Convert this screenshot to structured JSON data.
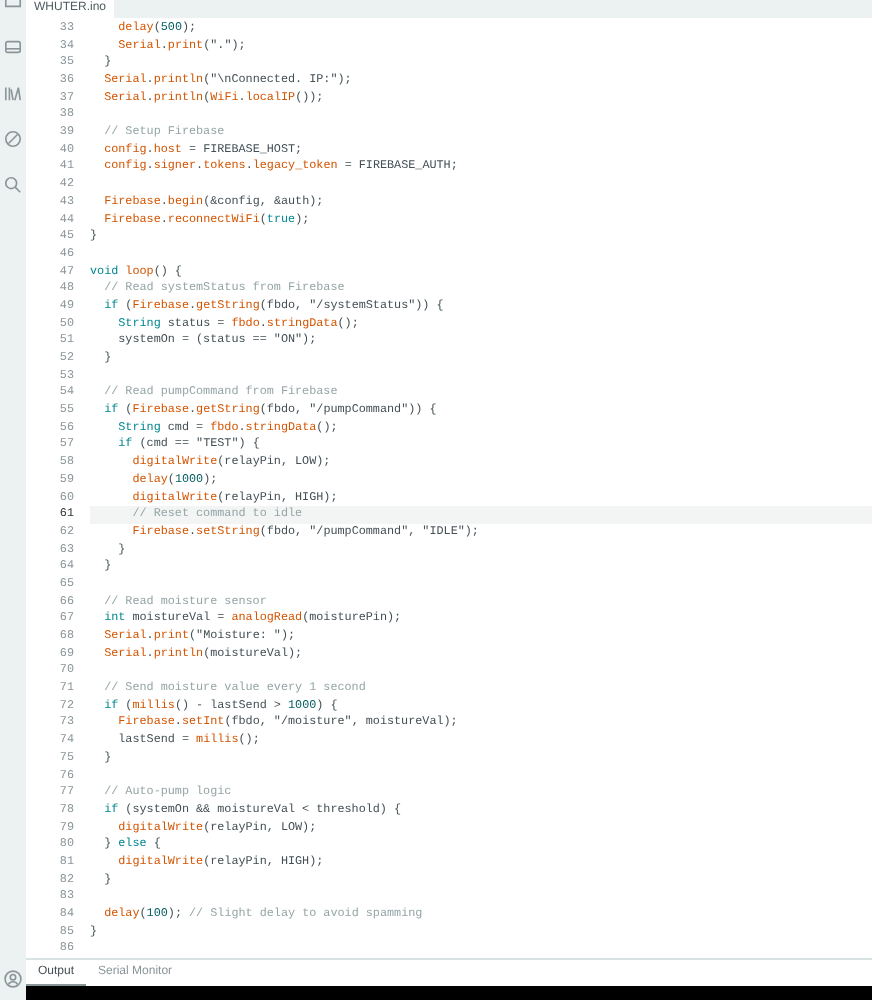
{
  "editor_tab": {
    "label": "WHUTER.ino",
    "selected": true
  },
  "lines": [
    {
      "number": "33",
      "active": false,
      "tokens": [
        {
          "kind": "fn",
          "text": "    delay"
        },
        {
          "kind": "plain",
          "text": "("
        },
        {
          "kind": "num",
          "text": "500"
        },
        {
          "kind": "plain",
          "text": ");"
        }
      ]
    },
    {
      "number": "34",
      "active": false,
      "tokens": [
        {
          "kind": "fn",
          "text": "    Serial"
        },
        {
          "kind": "plain",
          "text": "."
        },
        {
          "kind": "fn",
          "text": "print"
        },
        {
          "kind": "plain",
          "text": "(\".\");"
        }
      ]
    },
    {
      "number": "35",
      "active": false,
      "tokens": [
        {
          "kind": "plain",
          "text": "  }"
        }
      ]
    },
    {
      "number": "36",
      "active": false,
      "tokens": [
        {
          "kind": "fn",
          "text": "  Serial"
        },
        {
          "kind": "plain",
          "text": "."
        },
        {
          "kind": "fn",
          "text": "println"
        },
        {
          "kind": "plain",
          "text": "(\"\\nConnected. IP:\");"
        }
      ]
    },
    {
      "number": "37",
      "active": false,
      "tokens": [
        {
          "kind": "fn",
          "text": "  Serial"
        },
        {
          "kind": "plain",
          "text": "."
        },
        {
          "kind": "fn",
          "text": "println"
        },
        {
          "kind": "plain",
          "text": "("
        },
        {
          "kind": "fn",
          "text": "WiFi"
        },
        {
          "kind": "plain",
          "text": "."
        },
        {
          "kind": "fn",
          "text": "localIP"
        },
        {
          "kind": "plain",
          "text": "());"
        }
      ]
    },
    {
      "number": "38",
      "active": false
    },
    {
      "number": "39",
      "active": false,
      "tokens": [
        {
          "kind": "comment",
          "text": "  // Setup Firebase"
        }
      ]
    },
    {
      "number": "40",
      "active": false,
      "tokens": [
        {
          "kind": "fn",
          "text": "  config"
        },
        {
          "kind": "plain",
          "text": "."
        },
        {
          "kind": "fn",
          "text": "host"
        },
        {
          "kind": "plain",
          "text": " = FIREBASE_HOST;"
        }
      ]
    },
    {
      "number": "41",
      "active": false,
      "tokens": [
        {
          "kind": "fn",
          "text": "  config"
        },
        {
          "kind": "plain",
          "text": "."
        },
        {
          "kind": "fn",
          "text": "signer"
        },
        {
          "kind": "plain",
          "text": "."
        },
        {
          "kind": "fn",
          "text": "tokens"
        },
        {
          "kind": "plain",
          "text": "."
        },
        {
          "kind": "fn",
          "text": "legacy_token"
        },
        {
          "kind": "plain",
          "text": " = FIREBASE_AUTH;"
        }
      ]
    },
    {
      "number": "42",
      "active": false
    },
    {
      "number": "43",
      "active": false,
      "tokens": [
        {
          "kind": "fn",
          "text": "  Firebase"
        },
        {
          "kind": "plain",
          "text": "."
        },
        {
          "kind": "fn",
          "text": "begin"
        },
        {
          "kind": "plain",
          "text": "(&config, &auth);"
        }
      ]
    },
    {
      "number": "44",
      "active": false,
      "tokens": [
        {
          "kind": "fn",
          "text": "  Firebase"
        },
        {
          "kind": "plain",
          "text": "."
        },
        {
          "kind": "fn",
          "text": "reconnectWiFi"
        },
        {
          "kind": "plain",
          "text": "("
        },
        {
          "kind": "kw",
          "text": "true"
        },
        {
          "kind": "plain",
          "text": ");"
        }
      ]
    },
    {
      "number": "45",
      "active": false,
      "tokens": [
        {
          "kind": "plain",
          "text": "}"
        }
      ]
    },
    {
      "number": "46",
      "active": false
    },
    {
      "number": "47",
      "active": false,
      "tokens": [
        {
          "kind": "kw",
          "text": "void"
        },
        {
          "kind": "fn",
          "text": " loop"
        },
        {
          "kind": "plain",
          "text": "() {"
        }
      ]
    },
    {
      "number": "48",
      "active": false,
      "tokens": [
        {
          "kind": "comment",
          "text": "  // Read systemStatus from Firebase"
        }
      ]
    },
    {
      "number": "49",
      "active": false,
      "tokens": [
        {
          "kind": "kw",
          "text": "  if"
        },
        {
          "kind": "plain",
          "text": " ("
        },
        {
          "kind": "fn",
          "text": "Firebase"
        },
        {
          "kind": "plain",
          "text": "."
        },
        {
          "kind": "fn",
          "text": "getString"
        },
        {
          "kind": "plain",
          "text": "(fbdo, \"/systemStatus\")) {"
        }
      ]
    },
    {
      "number": "50",
      "active": false,
      "tokens": [
        {
          "kind": "kw",
          "text": "    String"
        },
        {
          "kind": "plain",
          "text": " status = "
        },
        {
          "kind": "fn",
          "text": "fbdo"
        },
        {
          "kind": "plain",
          "text": "."
        },
        {
          "kind": "fn",
          "text": "stringData"
        },
        {
          "kind": "plain",
          "text": "();"
        }
      ]
    },
    {
      "number": "51",
      "active": false,
      "tokens": [
        {
          "kind": "plain",
          "text": "    systemOn = (status == \"ON\");"
        }
      ]
    },
    {
      "number": "52",
      "active": false,
      "tokens": [
        {
          "kind": "plain",
          "text": "  }"
        }
      ]
    },
    {
      "number": "53",
      "active": false
    },
    {
      "number": "54",
      "active": false,
      "tokens": [
        {
          "kind": "comment",
          "text": "  // Read pumpCommand from Firebase"
        }
      ]
    },
    {
      "number": "55",
      "active": false,
      "tokens": [
        {
          "kind": "kw",
          "text": "  if"
        },
        {
          "kind": "plain",
          "text": " ("
        },
        {
          "kind": "fn",
          "text": "Firebase"
        },
        {
          "kind": "plain",
          "text": "."
        },
        {
          "kind": "fn",
          "text": "getString"
        },
        {
          "kind": "plain",
          "text": "(fbdo, \"/pumpCommand\")) {"
        }
      ]
    },
    {
      "number": "56",
      "active": false,
      "tokens": [
        {
          "kind": "kw",
          "text": "    String"
        },
        {
          "kind": "plain",
          "text": " cmd = "
        },
        {
          "kind": "fn",
          "text": "fbdo"
        },
        {
          "kind": "plain",
          "text": "."
        },
        {
          "kind": "fn",
          "text": "stringData"
        },
        {
          "kind": "plain",
          "text": "();"
        }
      ]
    },
    {
      "number": "57",
      "active": false,
      "tokens": [
        {
          "kind": "kw",
          "text": "    if"
        },
        {
          "kind": "plain",
          "text": " (cmd == \"TEST\") {"
        }
      ]
    },
    {
      "number": "58",
      "active": false,
      "tokens": [
        {
          "kind": "fn",
          "text": "      digitalWrite"
        },
        {
          "kind": "plain",
          "text": "(relayPin, LOW);"
        }
      ]
    },
    {
      "number": "59",
      "active": false,
      "tokens": [
        {
          "kind": "fn",
          "text": "      delay"
        },
        {
          "kind": "plain",
          "text": "("
        },
        {
          "kind": "num",
          "text": "1000"
        },
        {
          "kind": "plain",
          "text": ");"
        }
      ]
    },
    {
      "number": "60",
      "active": false,
      "tokens": [
        {
          "kind": "fn",
          "text": "      digitalWrite"
        },
        {
          "kind": "plain",
          "text": "(relayPin, HIGH);"
        }
      ]
    },
    {
      "number": "61",
      "active": true,
      "tokens": [
        {
          "kind": "comment",
          "text": "      // Reset command to idle"
        }
      ]
    },
    {
      "number": "62",
      "active": false,
      "tokens": [
        {
          "kind": "fn",
          "text": "      Firebase"
        },
        {
          "kind": "plain",
          "text": "."
        },
        {
          "kind": "fn",
          "text": "setString"
        },
        {
          "kind": "plain",
          "text": "(fbdo, \"/pumpCommand\", \"IDLE\");"
        }
      ]
    },
    {
      "number": "63",
      "active": false,
      "tokens": [
        {
          "kind": "plain",
          "text": "    }"
        }
      ]
    },
    {
      "number": "64",
      "active": false,
      "tokens": [
        {
          "kind": "plain",
          "text": "  }"
        }
      ]
    },
    {
      "number": "65",
      "active": false
    },
    {
      "number": "66",
      "active": false,
      "tokens": [
        {
          "kind": "comment",
          "text": "  // Read moisture sensor"
        }
      ]
    },
    {
      "number": "67",
      "active": false,
      "tokens": [
        {
          "kind": "kw",
          "text": "  int"
        },
        {
          "kind": "plain",
          "text": " moistureVal = "
        },
        {
          "kind": "fn",
          "text": "analogRead"
        },
        {
          "kind": "plain",
          "text": "(moisturePin);"
        }
      ]
    },
    {
      "number": "68",
      "active": false,
      "tokens": [
        {
          "kind": "fn",
          "text": "  Serial"
        },
        {
          "kind": "plain",
          "text": "."
        },
        {
          "kind": "fn",
          "text": "print"
        },
        {
          "kind": "plain",
          "text": "(\"Moisture: \");"
        }
      ]
    },
    {
      "number": "69",
      "active": false,
      "tokens": [
        {
          "kind": "fn",
          "text": "  Serial"
        },
        {
          "kind": "plain",
          "text": "."
        },
        {
          "kind": "fn",
          "text": "println"
        },
        {
          "kind": "plain",
          "text": "(moistureVal);"
        }
      ]
    },
    {
      "number": "70",
      "active": false
    },
    {
      "number": "71",
      "active": false,
      "tokens": [
        {
          "kind": "comment",
          "text": "  // Send moisture value every 1 second"
        }
      ]
    },
    {
      "number": "72",
      "active": false,
      "tokens": [
        {
          "kind": "kw",
          "text": "  if"
        },
        {
          "kind": "plain",
          "text": " ("
        },
        {
          "kind": "fn",
          "text": "millis"
        },
        {
          "kind": "plain",
          "text": "() - lastSend > "
        },
        {
          "kind": "num",
          "text": "1000"
        },
        {
          "kind": "plain",
          "text": ") {"
        }
      ]
    },
    {
      "number": "73",
      "active": false,
      "tokens": [
        {
          "kind": "fn",
          "text": "    Firebase"
        },
        {
          "kind": "plain",
          "text": "."
        },
        {
          "kind": "fn",
          "text": "setInt"
        },
        {
          "kind": "plain",
          "text": "(fbdo, \"/moisture\", moistureVal);"
        }
      ]
    },
    {
      "number": "74",
      "active": false,
      "tokens": [
        {
          "kind": "plain",
          "text": "    lastSend = "
        },
        {
          "kind": "fn",
          "text": "millis"
        },
        {
          "kind": "plain",
          "text": "();"
        }
      ]
    },
    {
      "number": "75",
      "active": false,
      "tokens": [
        {
          "kind": "plain",
          "text": "  }"
        }
      ]
    },
    {
      "number": "76",
      "active": false
    },
    {
      "number": "77",
      "active": false,
      "tokens": [
        {
          "kind": "comment",
          "text": "  // Auto-pump logic"
        }
      ]
    },
    {
      "number": "78",
      "active": false,
      "tokens": [
        {
          "kind": "kw",
          "text": "  if"
        },
        {
          "kind": "plain",
          "text": " (systemOn && moistureVal < threshold) {"
        }
      ]
    },
    {
      "number": "79",
      "active": false,
      "tokens": [
        {
          "kind": "fn",
          "text": "    digitalWrite"
        },
        {
          "kind": "plain",
          "text": "(relayPin, LOW);"
        }
      ]
    },
    {
      "number": "80",
      "active": false,
      "tokens": [
        {
          "kind": "plain",
          "text": "  } "
        },
        {
          "kind": "kw",
          "text": "else"
        },
        {
          "kind": "plain",
          "text": " {"
        }
      ]
    },
    {
      "number": "81",
      "active": false,
      "tokens": [
        {
          "kind": "fn",
          "text": "    digitalWrite"
        },
        {
          "kind": "plain",
          "text": "(relayPin, HIGH);"
        }
      ]
    },
    {
      "number": "82",
      "active": false,
      "tokens": [
        {
          "kind": "plain",
          "text": "  }"
        }
      ]
    },
    {
      "number": "83",
      "active": false
    },
    {
      "number": "84",
      "active": false,
      "tokens": [
        {
          "kind": "fn",
          "text": "  delay"
        },
        {
          "kind": "plain",
          "text": "("
        },
        {
          "kind": "num",
          "text": "100"
        },
        {
          "kind": "plain",
          "text": "); "
        },
        {
          "kind": "comment",
          "text": "// Slight delay to avoid spamming"
        }
      ]
    },
    {
      "number": "85",
      "active": false,
      "tokens": [
        {
          "kind": "plain",
          "text": "}"
        }
      ]
    },
    {
      "number": "86",
      "active": false
    }
  ],
  "panel_tabs": [
    {
      "label": "Output",
      "selected": true
    },
    {
      "label": "Serial Monitor",
      "selected": false
    }
  ]
}
